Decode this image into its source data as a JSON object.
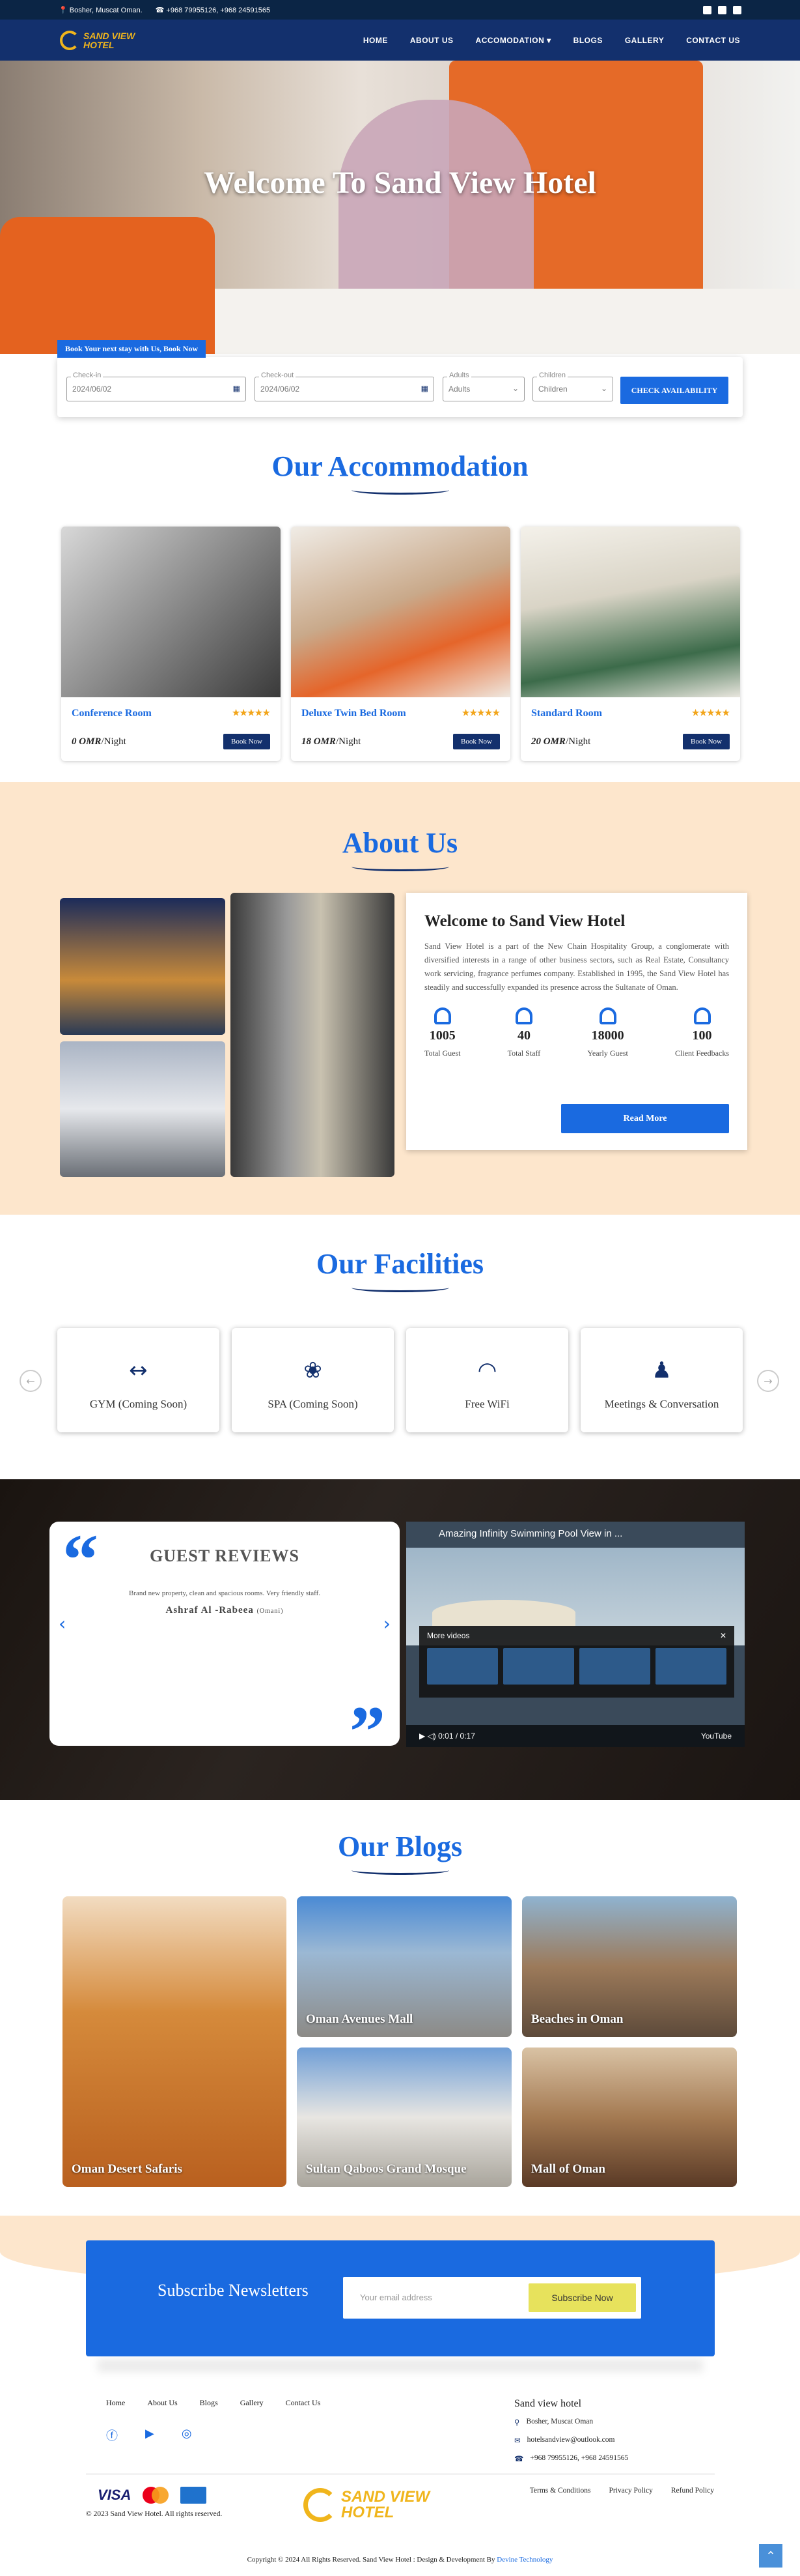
{
  "topbar": {
    "address": "Bosher, Muscat Oman.",
    "phone": "+968 79955126, +968 24591565"
  },
  "brand": {
    "line1": "SAND VIEW",
    "line2": "HOTEL"
  },
  "nav": [
    "HOME",
    "ABOUT US",
    "ACCOMODATION ▾",
    "BLOGS",
    "GALLERY",
    "CONTACT US"
  ],
  "hero": {
    "title": "Welcome To Sand View Hotel"
  },
  "booking": {
    "tag": "Book Your next stay with Us, Book Now",
    "checkin_label": "Check-in",
    "checkin": "2024/06/02",
    "checkout_label": "Check-out",
    "checkout": "2024/06/02",
    "adults_label": "Adults",
    "adults": "Adults",
    "children_label": "Children",
    "children": "Children",
    "button": "CHECK AVAILABILITY"
  },
  "accommodation": {
    "title": "Our Accommodation",
    "rooms": [
      {
        "name": "Conference Room",
        "price": "0 OMR",
        "unit": "/Night",
        "button": "Book Now",
        "stars": "★★★★★"
      },
      {
        "name": "Deluxe Twin Bed Room",
        "price": "18 OMR",
        "unit": "/Night",
        "button": "Book Now",
        "stars": "★★★★★"
      },
      {
        "name": "Standard Room",
        "price": "20 OMR",
        "unit": "/Night",
        "button": "Book Now",
        "stars": "★★★★★"
      }
    ]
  },
  "about": {
    "title": "About Us",
    "heading": "Welcome to Sand View Hotel",
    "text": "Sand View Hotel is a part of the New Chain Hospitality Group, a conglomerate with diversified interests in a range of other business sectors, such as Real Estate, Consultancy work servicing, fragrance perfumes company. Established in 1995, the Sand View Hotel has steadily and successfully expanded its presence across the Sultanate of Oman.",
    "stats": [
      {
        "n": "1005",
        "l": "Total Guest"
      },
      {
        "n": "40",
        "l": "Total Staff"
      },
      {
        "n": "18000",
        "l": "Yearly Guest"
      },
      {
        "n": "100",
        "l": "Client Feedbacks"
      }
    ],
    "button": "Read More"
  },
  "facilities": {
    "title": "Our Facilities",
    "items": [
      {
        "icon": "↔",
        "label": "GYM (Coming Soon)"
      },
      {
        "icon": "❀",
        "label": "SPA (Coming Soon)"
      },
      {
        "icon": "◠",
        "label": "Free WiFi"
      },
      {
        "icon": "♟",
        "label": "Meetings & Conversation"
      }
    ]
  },
  "reviews": {
    "heading": "GUEST REVIEWS",
    "text": "Brand new property, clean and spacious rooms. Very friendly staff.",
    "author": "Ashraf Al -Rabeea",
    "country": "(Omani)"
  },
  "video": {
    "title": "Amazing Infinity Swimming Pool View in ...",
    "more": "More videos",
    "time": "0:01 / 0:17",
    "brand": "YouTube"
  },
  "blogs": {
    "title": "Our Blogs",
    "items": [
      "Oman Desert Safaris",
      "Oman Avenues Mall",
      "Beaches in Oman",
      "Sultan Qaboos Grand Mosque",
      "Mall of Oman"
    ]
  },
  "subscribe": {
    "title": "Subscribe Newsletters",
    "placeholder": "Your email address",
    "button": "Subscribe Now"
  },
  "footer": {
    "links": [
      "Home",
      "About Us",
      "Blogs",
      "Gallery",
      "Contact Us"
    ],
    "contact_title": "Sand view hotel",
    "address": "Bosher, Muscat Oman",
    "email": "hotelsandview@outlook.com",
    "phone": "+968 79955126, +968 24591565",
    "legal": [
      "Terms & Conditions",
      "Privacy Policy",
      "Refund Policy"
    ],
    "copy1": "© 2023 Sand View Hotel. All rights reserved.",
    "copy2": "Copyright © 2024 All Rights Reserved. Sand View Hotel : Design & Development By",
    "dev": "Devine Technology",
    "visa": "VISA"
  }
}
